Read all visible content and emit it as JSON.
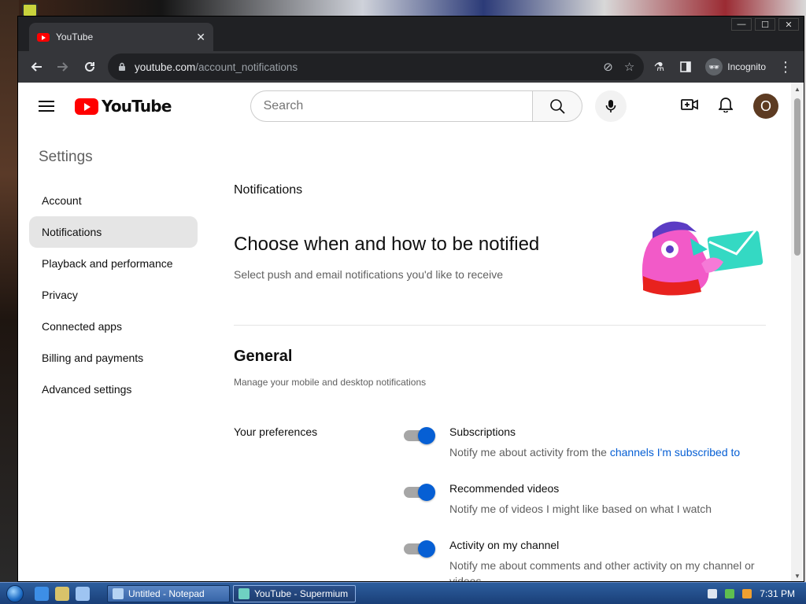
{
  "browser": {
    "tab_title": "YouTube",
    "url_host": "youtube.com",
    "url_path": "/account_notifications",
    "incognito_label": "Incognito",
    "window_buttons": [
      "—",
      "☐",
      "✕"
    ]
  },
  "youtube_header": {
    "logo_text": "YouTube",
    "search_placeholder": "Search",
    "avatar_letter": "O"
  },
  "sidebar": {
    "title": "Settings",
    "items": [
      {
        "label": "Account",
        "active": false
      },
      {
        "label": "Notifications",
        "active": true
      },
      {
        "label": "Playback and performance",
        "active": false
      },
      {
        "label": "Privacy",
        "active": false
      },
      {
        "label": "Connected apps",
        "active": false
      },
      {
        "label": "Billing and payments",
        "active": false
      },
      {
        "label": "Advanced settings",
        "active": false
      }
    ]
  },
  "content": {
    "heading": "Notifications",
    "title": "Choose when and how to be notified",
    "subtitle": "Select push and email notifications you'd like to receive",
    "general": {
      "title": "General",
      "subtitle": "Manage your mobile and desktop notifications",
      "prefs_label": "Your preferences",
      "prefs": [
        {
          "name": "Subscriptions",
          "desc": "Notify me about activity from the ",
          "link": "channels I'm subscribed to",
          "enabled": true
        },
        {
          "name": "Recommended videos",
          "desc": "Notify me of videos I might like based on what I watch",
          "link": "",
          "enabled": true
        },
        {
          "name": "Activity on my channel",
          "desc": "Notify me about comments and other activity on my channel or videos",
          "link": "",
          "enabled": true
        }
      ]
    }
  },
  "taskbar": {
    "tasks": [
      {
        "label": "Untitled - Notepad",
        "active": false
      },
      {
        "label": "YouTube - Supermium",
        "active": true
      }
    ],
    "clock": "7:31 PM"
  },
  "colors": {
    "accent_blue": "#065fd4",
    "youtube_red": "#ff0000",
    "browser_dark": "#202124",
    "avatar_bg": "#5d3b22"
  }
}
